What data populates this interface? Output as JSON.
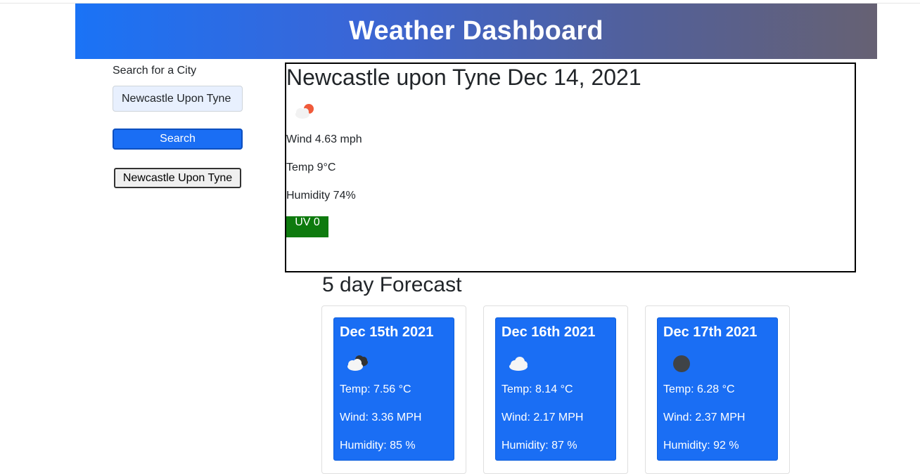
{
  "header": {
    "title": "Weather Dashboard"
  },
  "search": {
    "label": "Search for a City",
    "input_value": "Newcastle Upon Tyne",
    "button_label": "Search",
    "history": [
      "Newcastle Upon Tyne"
    ]
  },
  "current": {
    "heading": "Newcastle upon Tyne Dec 14, 2021",
    "icon": "cloud-sun-icon",
    "wind": "Wind 4.63 mph",
    "temp": "Temp 9°C",
    "humidity": "Humidity 74%",
    "uv": "UV 0",
    "uv_color": "#0e7a0e"
  },
  "forecast": {
    "title": "5 day Forecast",
    "days": [
      {
        "date": "Dec 15th 2021",
        "icon": "broken-clouds-icon",
        "temp": "Temp: 7.56 °C",
        "wind": "Wind: 3.36 MPH",
        "humidity": "Humidity: 85 %"
      },
      {
        "date": "Dec 16th 2021",
        "icon": "cloud-icon",
        "temp": "Temp: 8.14 °C",
        "wind": "Wind: 2.17 MPH",
        "humidity": "Humidity: 87 %"
      },
      {
        "date": "Dec 17th 2021",
        "icon": "dark-circle-icon",
        "temp": "Temp: 6.28 °C",
        "wind": "Wind: 2.37 MPH",
        "humidity": "Humidity: 92 %"
      }
    ]
  },
  "colors": {
    "accent": "#1a6ef4",
    "header_gradient_start": "#1a73f6",
    "header_gradient_end": "#666173"
  }
}
